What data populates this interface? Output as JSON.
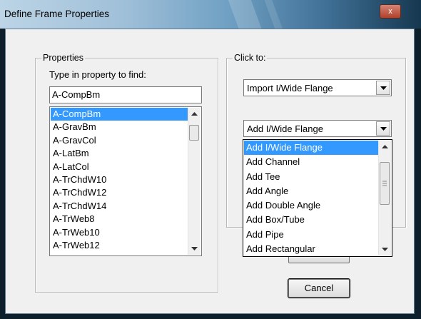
{
  "window": {
    "title": "Define Frame Properties",
    "close_glyph": "x"
  },
  "properties_group": {
    "legend": "Properties",
    "find_label": "Type in property to find:",
    "find_value": "A-CompBm",
    "items": [
      "A-CompBm",
      "A-GravBm",
      "A-GravCol",
      "A-LatBm",
      "A-LatCol",
      "A-TrChdW10",
      "A-TrChdW12",
      "A-TrChdW14",
      "A-TrWeb8",
      "A-TrWeb10",
      "A-TrWeb12"
    ],
    "selected_index": 0
  },
  "click_to_group": {
    "legend": "Click to:",
    "import_combo_value": "Import I/Wide Flange",
    "add_combo_value": "Add I/Wide Flange",
    "add_options": [
      "Add I/Wide Flange",
      "Add Channel",
      "Add Tee",
      "Add Angle",
      "Add Double Angle",
      "Add Box/Tube",
      "Add Pipe",
      "Add Rectangular"
    ],
    "selected_option_index": 0
  },
  "buttons": {
    "cancel": "Cancel"
  },
  "icons": {
    "close": "close-icon",
    "dropdown": "chevron-down-icon",
    "scroll_up": "scroll-up-arrow-icon",
    "scroll_down": "scroll-down-arrow-icon"
  },
  "colors": {
    "selection": "#3399ff",
    "dialog_bg": "#f0f0f0"
  }
}
